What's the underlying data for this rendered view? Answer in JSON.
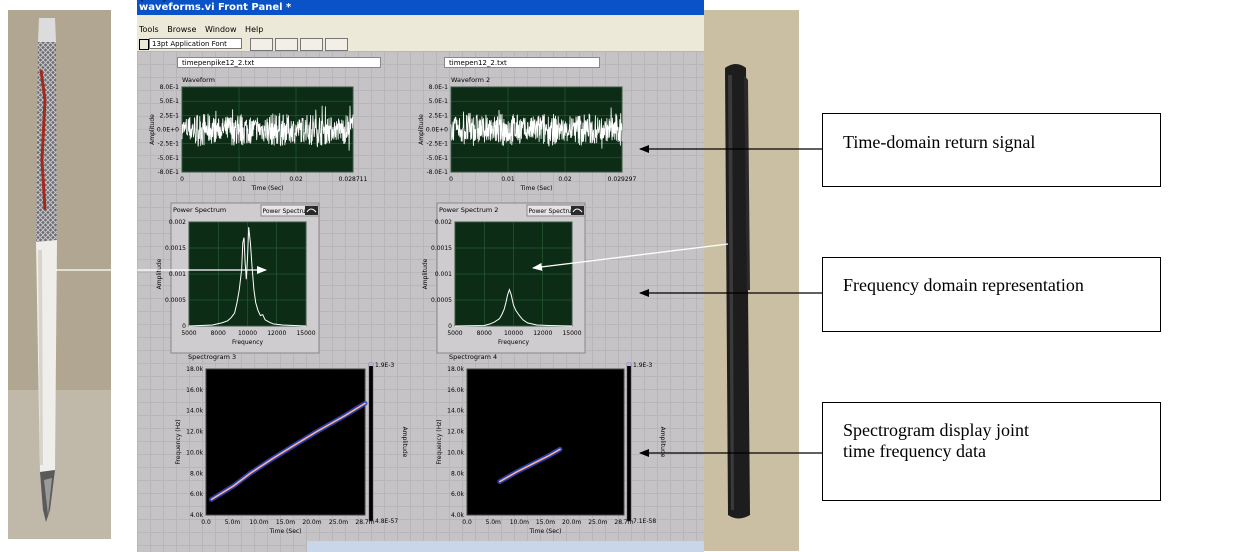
{
  "window": {
    "title": "waveforms.vi Front Panel *",
    "menus": [
      "Tools",
      "Browse",
      "Window",
      "Help"
    ],
    "font_selector": "13pt Application Font"
  },
  "files": {
    "left": "timepenpike12_2.txt",
    "right": "timepen12_2.txt"
  },
  "chart_data": [
    {
      "type": "line",
      "title": "Waveform",
      "xlabel": "Time (Sec)",
      "ylabel": "Amplitude",
      "x_ticks": [
        "0",
        "0.01",
        "0.02",
        "0.028711"
      ],
      "y_ticks": [
        "8.0E-1",
        "5.0E-1",
        "2.5E-1",
        "0.0E+0",
        "-2.5E-1",
        "-5.0E-1",
        "-8.0E-1"
      ],
      "xlim": [
        0,
        0.028711
      ],
      "ylim": [
        -0.8,
        0.8
      ],
      "grid": true,
      "colors": {
        "plot_bg": "#0c2c16",
        "trace": "#ffffff"
      }
    },
    {
      "type": "line",
      "title": "Waveform 2",
      "xlabel": "Time (Sec)",
      "ylabel": "Amplitude",
      "x_ticks": [
        "0",
        "0.01",
        "0.02",
        "0.029297"
      ],
      "y_ticks": [
        "8.0E-1",
        "5.0E-1",
        "2.5E-1",
        "0.0E+0",
        "-2.5E-1",
        "-5.0E-1",
        "-8.0E-1"
      ],
      "xlim": [
        0,
        0.029297
      ],
      "ylim": [
        -0.8,
        0.8
      ],
      "grid": true,
      "colors": {
        "plot_bg": "#0c2c16",
        "trace": "#ffffff"
      }
    },
    {
      "type": "line",
      "title": "Power Spectrum",
      "selector": "Power Spectrum",
      "xlabel": "Frequency",
      "ylabel": "Amplitude",
      "x_ticks": [
        "5000",
        "8000",
        "10000",
        "12000",
        "15000"
      ],
      "y_ticks": [
        "0.002",
        "0.0015",
        "0.001",
        "0.0005",
        "0"
      ],
      "xlim": [
        5000,
        15000
      ],
      "ylim": [
        0,
        0.002
      ],
      "grid": true,
      "points": [
        [
          5000,
          0
        ],
        [
          7000,
          2e-05
        ],
        [
          7800,
          6e-05
        ],
        [
          8300,
          0.0001
        ],
        [
          8600,
          0.00016
        ],
        [
          8900,
          0.00025
        ],
        [
          9100,
          0.00045
        ],
        [
          9300,
          0.0007
        ],
        [
          9500,
          0.0011
        ],
        [
          9600,
          0.0016
        ],
        [
          9700,
          0.0017
        ],
        [
          9800,
          0.0012
        ],
        [
          9900,
          0.0009
        ],
        [
          10000,
          0.0013
        ],
        [
          10100,
          0.0019
        ],
        [
          10250,
          0.0016
        ],
        [
          10400,
          0.0011
        ],
        [
          10550,
          0.0007
        ],
        [
          10700,
          0.00045
        ],
        [
          10900,
          0.0003
        ],
        [
          11100,
          0.0002
        ],
        [
          11300,
          0.00022
        ],
        [
          11500,
          0.00012
        ],
        [
          11800,
          8e-05
        ],
        [
          12200,
          4e-05
        ],
        [
          13000,
          2e-05
        ],
        [
          15000,
          0
        ]
      ],
      "colors": {
        "plot_bg": "#0c2c16",
        "trace": "#ffffff"
      }
    },
    {
      "type": "line",
      "title": "Power Spectrum 2",
      "selector": "Power Spectrum",
      "xlabel": "Frequency",
      "ylabel": "Amplitude",
      "x_ticks": [
        "5000",
        "8000",
        "10000",
        "12000",
        "15000"
      ],
      "y_ticks": [
        "0.002",
        "0.0015",
        "0.001",
        "0.0005",
        "0"
      ],
      "xlim": [
        5000,
        15000
      ],
      "ylim": [
        0,
        0.002
      ],
      "grid": true,
      "points": [
        [
          5000,
          0
        ],
        [
          7500,
          1e-05
        ],
        [
          8000,
          4e-05
        ],
        [
          8400,
          8e-05
        ],
        [
          8800,
          0.00014
        ],
        [
          9000,
          0.00022
        ],
        [
          9200,
          0.00032
        ],
        [
          9350,
          0.00045
        ],
        [
          9500,
          0.0006
        ],
        [
          9650,
          0.0007
        ],
        [
          9800,
          0.0006
        ],
        [
          10000,
          0.0004
        ],
        [
          10200,
          0.0003
        ],
        [
          10500,
          0.0002
        ],
        [
          10800,
          0.00012
        ],
        [
          11200,
          6e-05
        ],
        [
          12000,
          2e-05
        ],
        [
          13000,
          1e-05
        ],
        [
          15000,
          0
        ]
      ],
      "colors": {
        "plot_bg": "#0c2c16",
        "trace": "#ffffff"
      }
    },
    {
      "type": "heatmap",
      "title": "Spectrogram 3",
      "xlabel": "Time (Sec)",
      "ylabel": "Frequency (Hz)",
      "zlabel": "Amplitude",
      "x_ticks": [
        "0.0",
        "5.0m",
        "10.0m",
        "15.0m",
        "20.0m",
        "25.0m",
        "28.7m"
      ],
      "y_ticks": [
        "18.0k",
        "16.0k",
        "14.0k",
        "12.0k",
        "10.0k",
        "8.0k",
        "6.0k",
        "4.0k"
      ],
      "xlim": [
        0,
        0.0287
      ],
      "ylim": [
        4000,
        18000
      ],
      "zmax_label": "1.9E-3",
      "zmin_label": "4.8E-57",
      "ridge": [
        [
          0.001,
          5500
        ],
        [
          0.005,
          6800
        ],
        [
          0.008,
          8000
        ],
        [
          0.012,
          9400
        ],
        [
          0.016,
          10700
        ],
        [
          0.02,
          12000
        ],
        [
          0.025,
          13500
        ],
        [
          0.0287,
          14700
        ]
      ],
      "colors": {
        "plot_bg": "#000000",
        "ridge_core": "#ffb090",
        "ridge_halo": "#2e47c8"
      }
    },
    {
      "type": "heatmap",
      "title": "Spectrogram 4",
      "xlabel": "Time (Sec)",
      "ylabel": "Frequency (Hz)",
      "zlabel": "Amplitude",
      "x_ticks": [
        "0.0",
        "5.0m",
        "10.0m",
        "15.0m",
        "20.0m",
        "25.0m",
        "28.7m"
      ],
      "y_ticks": [
        "18.0k",
        "16.0k",
        "14.0k",
        "12.0k",
        "10.0k",
        "8.0k",
        "6.0k",
        "4.0k"
      ],
      "xlim": [
        0,
        0.0287
      ],
      "ylim": [
        4000,
        18000
      ],
      "zmax_label": "1.9E-3",
      "zmin_label": "7.1E-58",
      "ridge": [
        [
          0.006,
          7200
        ],
        [
          0.009,
          8100
        ],
        [
          0.012,
          8900
        ],
        [
          0.015,
          9700
        ],
        [
          0.017,
          10300
        ]
      ],
      "colors": {
        "plot_bg": "#000000",
        "ridge_core": "#ffb090",
        "ridge_halo": "#2e47c8"
      }
    }
  ],
  "callouts": {
    "time_domain": "Time-domain return signal",
    "freq_domain": "Frequency domain representation",
    "spectrogram_line1": "Spectrogram display joint",
    "spectrogram_line2": "time frequency data"
  }
}
